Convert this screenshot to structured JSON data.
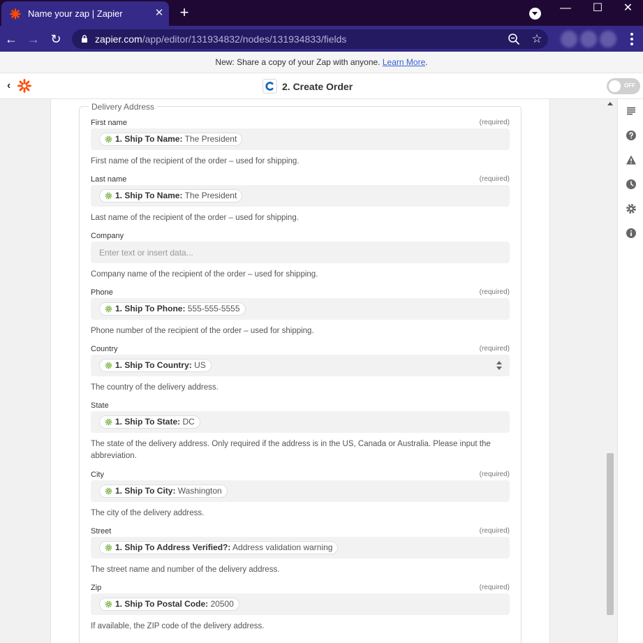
{
  "browser": {
    "tab_title": "Name your zap | Zapier",
    "tab_close": "✕",
    "new_tab": "+",
    "minimize": "—",
    "maximize": "☐",
    "close": "✕",
    "back": "←",
    "forward": "→",
    "reload": "↻",
    "url_host": "zapier.com",
    "url_path": "/app/editor/131934832/nodes/131934833/fields",
    "star": "☆",
    "accent": "#352a87",
    "frame": "#1f0934"
  },
  "banner": {
    "text": "New: Share a copy of your Zap with anyone. ",
    "link": "Learn More",
    "after": "."
  },
  "header": {
    "back": "‹",
    "step_title": "2. Create Order",
    "toggle_label": "OFF"
  },
  "form": {
    "section_title": "Delivery Address",
    "fields": [
      {
        "label": "First name",
        "required": "(required)",
        "pill_key": "1. Ship To Name:",
        "pill_value": "The President",
        "help": "First name of the recipient of the order – used for shipping."
      },
      {
        "label": "Last name",
        "required": "(required)",
        "pill_key": "1. Ship To Name:",
        "pill_value": "The President",
        "help": "Last name of the recipient of the order – used for shipping."
      },
      {
        "label": "Company",
        "placeholder": "Enter text or insert data...",
        "help": "Company name of the recipient of the order – used for shipping."
      },
      {
        "label": "Phone",
        "required": "(required)",
        "pill_key": "1. Ship To Phone:",
        "pill_value": "555-555-5555",
        "help": "Phone number of the recipient of the order – used for shipping."
      },
      {
        "label": "Country",
        "required": "(required)",
        "pill_key": "1. Ship To Country:",
        "pill_value": "US",
        "help": "The country of the delivery address."
      },
      {
        "label": "State",
        "pill_key": "1. Ship To State:",
        "pill_value": "DC",
        "help": "The state of the delivery address. Only required if the address is in the US, Canada or Australia. Please input the abbreviation."
      },
      {
        "label": "City",
        "required": "(required)",
        "pill_key": "1. Ship To City:",
        "pill_value": "Washington",
        "help": "The city of the delivery address."
      },
      {
        "label": "Street",
        "required": "(required)",
        "pill_key": "1. Ship To Address Verified?:",
        "pill_value": "Address validation warning",
        "help": "The street name and number of the delivery address."
      },
      {
        "label": "Zip",
        "required": "(required)",
        "pill_key": "1. Ship To Postal Code:",
        "pill_value": "20500",
        "help": "If available, the ZIP code of the delivery address."
      }
    ]
  },
  "sidebar_icons": [
    "list-icon",
    "help-icon",
    "warning-icon",
    "clock-icon",
    "settings-icon",
    "info-icon"
  ],
  "colors": {
    "zapier_orange": "#ff4a00",
    "pill_gear": "#7cb342",
    "link": "#3661d3"
  }
}
